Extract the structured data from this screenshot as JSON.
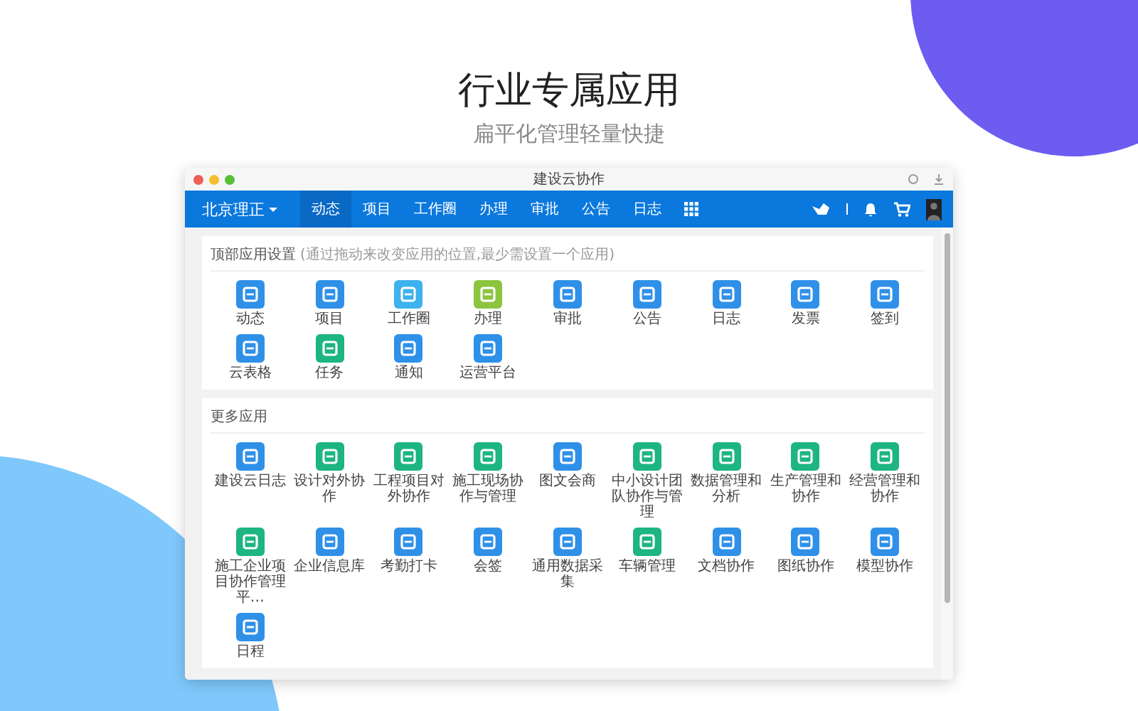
{
  "heading": "行业专属应用",
  "subheading": "扁平化管理轻量快捷",
  "window": {
    "title": "建设云协作"
  },
  "nav": {
    "org": "北京理正",
    "items": [
      {
        "label": "动态",
        "selected": true
      },
      {
        "label": "项目",
        "selected": false
      },
      {
        "label": "工作圈",
        "selected": false
      },
      {
        "label": "办理",
        "selected": false
      },
      {
        "label": "审批",
        "selected": false
      },
      {
        "label": "公告",
        "selected": false
      },
      {
        "label": "日志",
        "selected": false
      }
    ]
  },
  "top_apps": {
    "title": "顶部应用设置",
    "hint": "(通过拖动来改变应用的位置,最少需设置一个应用)",
    "apps": [
      {
        "label": "动态",
        "color": "#2f90e8"
      },
      {
        "label": "项目",
        "color": "#2f90e8"
      },
      {
        "label": "工作圈",
        "color": "#3db2ee"
      },
      {
        "label": "办理",
        "color": "#8cc43f"
      },
      {
        "label": "审批",
        "color": "#2f90e8"
      },
      {
        "label": "公告",
        "color": "#2f90e8"
      },
      {
        "label": "日志",
        "color": "#2f90e8"
      },
      {
        "label": "发票",
        "color": "#2f90e8"
      },
      {
        "label": "签到",
        "color": "#2f90e8"
      },
      {
        "label": "云表格",
        "color": "#2f90e8"
      },
      {
        "label": "任务",
        "color": "#1db580"
      },
      {
        "label": "通知",
        "color": "#2f90e8"
      },
      {
        "label": "运营平台",
        "color": "#2f90e8"
      }
    ]
  },
  "more_apps": {
    "title": "更多应用",
    "apps": [
      {
        "label": "建设云日志",
        "color": "#2f90e8"
      },
      {
        "label": "设计对外协作",
        "color": "#1db580"
      },
      {
        "label": "工程项目对外协作",
        "color": "#1db580"
      },
      {
        "label": "施工现场协作与管理",
        "color": "#1db580"
      },
      {
        "label": "图文会商",
        "color": "#2f90e8"
      },
      {
        "label": "中小设计团队协作与管理",
        "color": "#1db580"
      },
      {
        "label": "数据管理和分析",
        "color": "#1db580"
      },
      {
        "label": "生产管理和协作",
        "color": "#1db580"
      },
      {
        "label": "经营管理和协作",
        "color": "#1db580"
      },
      {
        "label": "施工企业项目协作管理平…",
        "color": "#1db580"
      },
      {
        "label": "企业信息库",
        "color": "#2f90e8"
      },
      {
        "label": "考勤打卡",
        "color": "#2f90e8"
      },
      {
        "label": "会签",
        "color": "#2f90e8"
      },
      {
        "label": "通用数据采集",
        "color": "#2f90e8"
      },
      {
        "label": "车辆管理",
        "color": "#1db580"
      },
      {
        "label": "文档协作",
        "color": "#2f90e8"
      },
      {
        "label": "图纸协作",
        "color": "#2f90e8"
      },
      {
        "label": "模型协作",
        "color": "#2f90e8"
      },
      {
        "label": "日程",
        "color": "#2f90e8"
      }
    ]
  }
}
